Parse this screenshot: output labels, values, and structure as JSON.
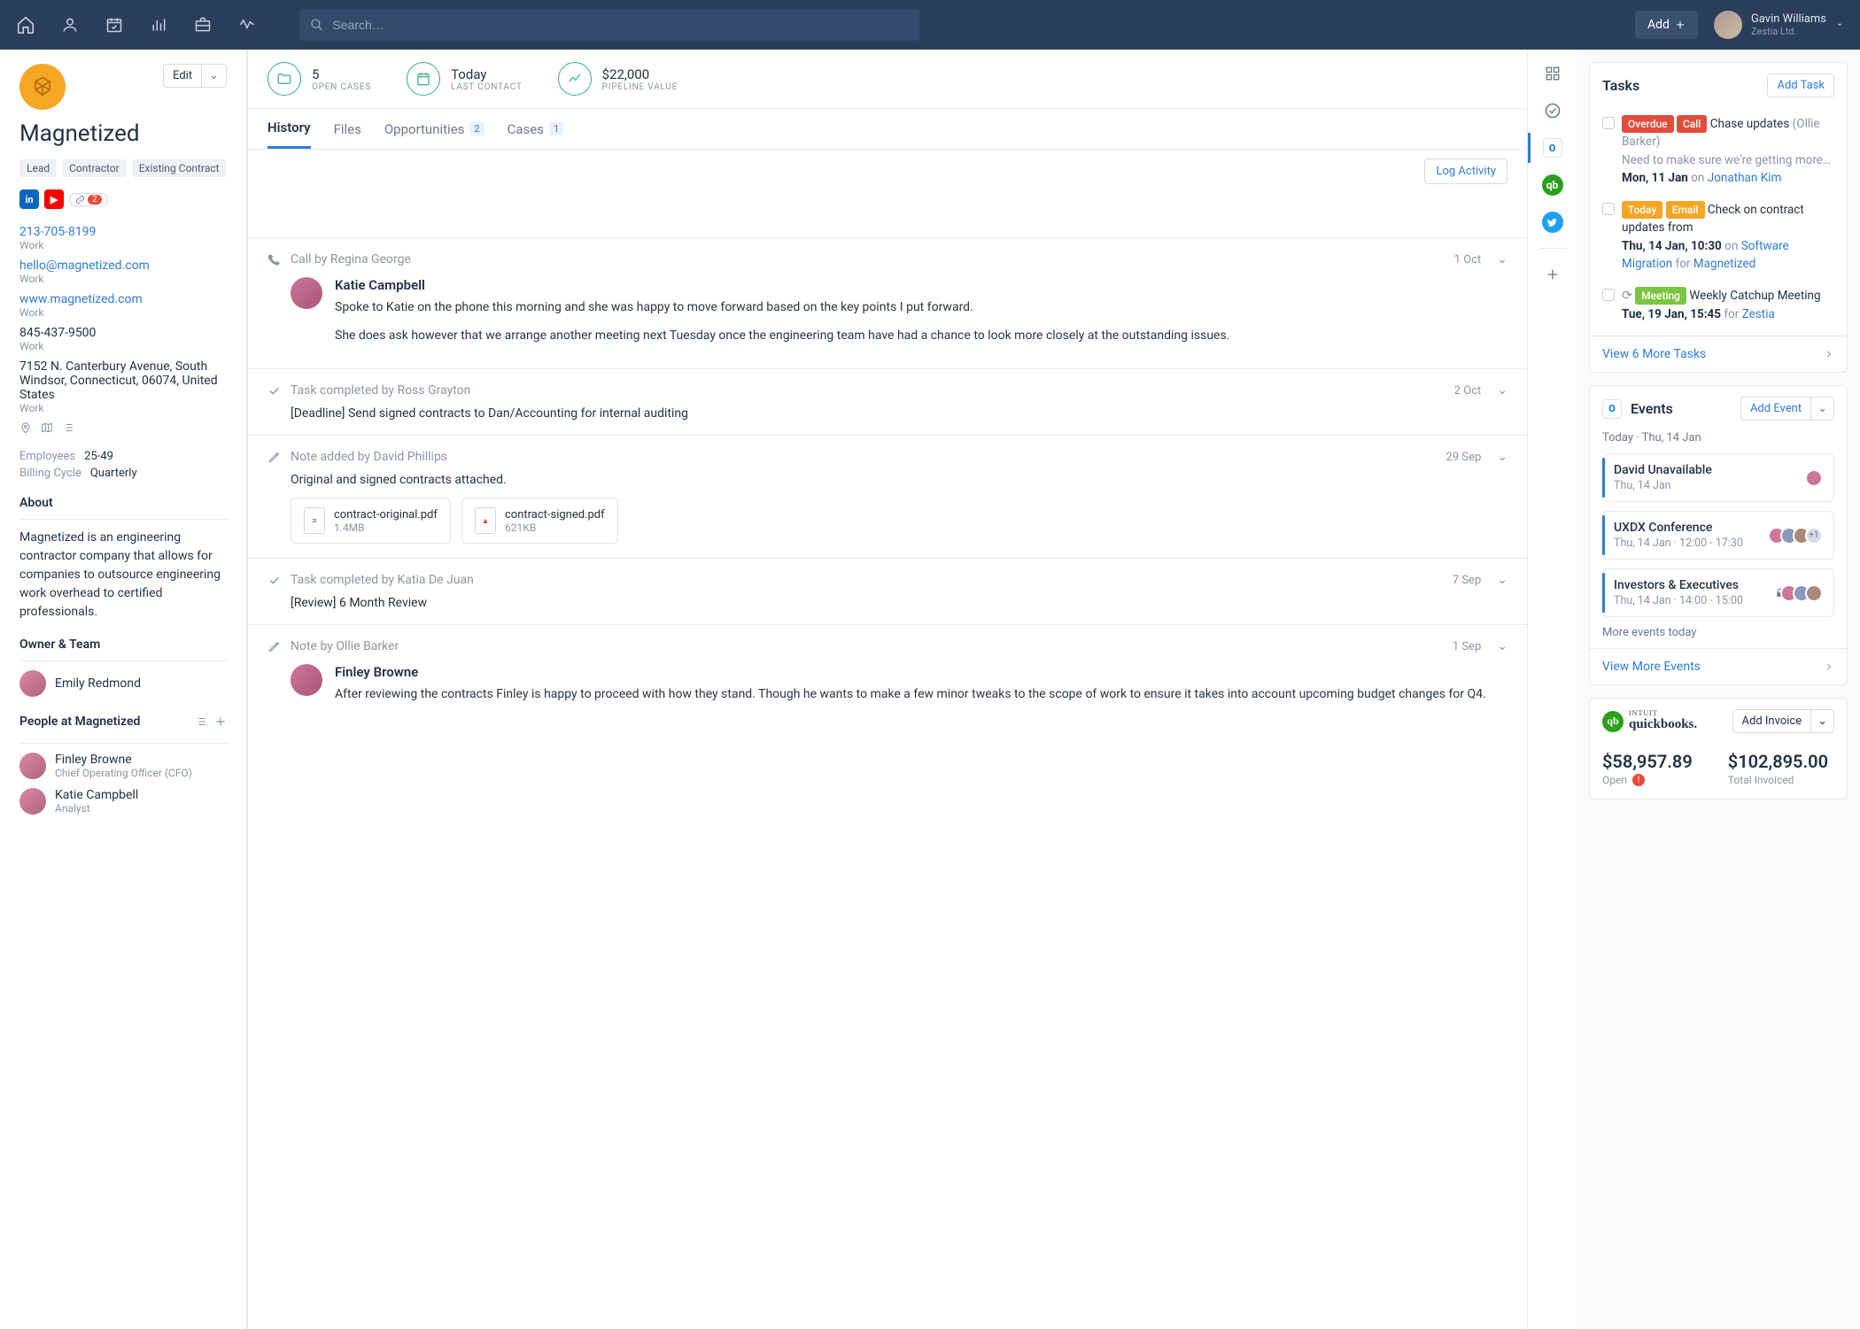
{
  "topnav": {
    "search_placeholder": "Search…",
    "add_label": "Add",
    "user": {
      "name": "Gavin Williams",
      "company": "Zestia Ltd."
    }
  },
  "org": {
    "name": "Magnetized",
    "edit_label": "Edit",
    "tags": [
      "Lead",
      "Contractor",
      "Existing Contract"
    ],
    "social_link_count": "2",
    "contacts": [
      {
        "value": "213-705-8199",
        "label": "Work",
        "link": true
      },
      {
        "value": "hello@magnetized.com",
        "label": "Work",
        "link": true
      },
      {
        "value": "www.magnetized.com",
        "label": "Work",
        "link": true
      },
      {
        "value": "845-437-9500",
        "label": "Work",
        "link": false
      },
      {
        "value": "7152 N. Canterbury Avenue, South Windsor, Connecticut, 06074, United States",
        "label": "Work",
        "link": false
      }
    ],
    "meta": [
      {
        "k": "Employees",
        "v": "25-49"
      },
      {
        "k": "Billing Cycle",
        "v": "Quarterly"
      }
    ],
    "about_title": "About",
    "about": "Magnetized is an engineering contractor company that allows for companies to outsource engineering work overhead to certified professionals.",
    "owner_title": "Owner & Team",
    "owner": {
      "name": "Emily Redmond"
    },
    "people_title": "People at Magnetized",
    "people": [
      {
        "name": "Finley Browne",
        "title": "Chief Operating Officer (CFO)"
      },
      {
        "name": "Katie Campbell",
        "title": "Analyst"
      }
    ]
  },
  "metrics": [
    {
      "value": "5",
      "label": "OPEN CASES",
      "icon": "folder"
    },
    {
      "value": "Today",
      "label": "LAST CONTACT",
      "icon": "calendar"
    },
    {
      "value": "$22,000",
      "label": "PIPELINE VALUE",
      "icon": "trend"
    }
  ],
  "tabs": {
    "history": "History",
    "files": "Files",
    "opportunities": "Opportunities",
    "opportunities_count": "2",
    "cases": "Cases",
    "cases_count": "1"
  },
  "log_activity_label": "Log Activity",
  "history": [
    {
      "type": "call",
      "title": "Call by Regina George",
      "date": "1 Oct",
      "entry": {
        "name": "Katie Campbell",
        "paras": [
          "Spoke to Katie on the phone this morning and she was happy to move forward based on the key points I put forward.",
          "She does ask however that we arrange another meeting next Tuesday once the engineering team have had a chance to look more closely at the outstanding issues."
        ]
      }
    },
    {
      "type": "task",
      "title": "Task completed by Ross Grayton",
      "date": "2 Oct",
      "simple": "[Deadline] Send signed contracts to Dan/Accounting for internal auditing"
    },
    {
      "type": "note",
      "title": "Note added by David Phillips",
      "date": "29 Sep",
      "simple": "Original and signed contracts attached.",
      "files": [
        {
          "name": "contract-original.pdf",
          "size": "1.4MB",
          "kind": "doc"
        },
        {
          "name": "contract-signed.pdf",
          "size": "621KB",
          "kind": "pdf"
        }
      ]
    },
    {
      "type": "task",
      "title": "Task completed by Katia De Juan",
      "date": "7 Sep",
      "simple": "[Review] 6 Month Review"
    },
    {
      "type": "note",
      "title": "Note by Ollie Barker",
      "date": "1 Sep",
      "entry": {
        "name": "Finley Browne",
        "paras": [
          "After reviewing the contracts Finley is happy to proceed with how they stand. Though he wants to make a few minor tweaks to the scope of work to ensure it takes into account upcoming budget changes for Q4."
        ]
      }
    }
  ],
  "tasks_panel": {
    "title": "Tasks",
    "add_label": "Add Task",
    "footer": "View 6 More Tasks",
    "items": [
      {
        "pills": [
          [
            "Overdue",
            "red"
          ],
          [
            "Call",
            "red"
          ]
        ],
        "text": "Chase updates",
        "paren": "(Ollie Barker)",
        "sub": "Need to make sure we're getting more…",
        "when": "Mon, 11 Jan",
        "on_prefix": "on",
        "on_link": "Jonathan Kim"
      },
      {
        "pills": [
          [
            "Today",
            "orange"
          ],
          [
            "Email",
            "orange"
          ]
        ],
        "text": "Check on contract updates from",
        "when": "Thu, 14 Jan, 10:30",
        "on_prefix": "on",
        "on_link": "Software Migration",
        "for_prefix": "for",
        "for_link": "Magnetized"
      },
      {
        "repeat": true,
        "pills": [
          [
            "Meeting",
            "green"
          ]
        ],
        "text": "Weekly Catchup Meeting",
        "when": "Tue, 19 Jan, 15:45",
        "for_prefix": "for",
        "for_link": "Zestia"
      }
    ]
  },
  "events_panel": {
    "title": "Events",
    "add_label": "Add Event",
    "subtitle": "Today · Thu, 14 Jan",
    "items": [
      {
        "title": "David Unavailable",
        "time": "Thu, 14 Jan",
        "avatars": 1
      },
      {
        "title": "UXDX Conference",
        "time": "Thu, 14 Jan · 12:00 - 17:30",
        "avatars": 3,
        "more": "+1"
      },
      {
        "title": "Investors & Executives",
        "time": "Thu, 14 Jan · 14:00 - 15:00",
        "avatars": 3,
        "lock": true
      }
    ],
    "more_note": "More events today",
    "footer": "View More Events"
  },
  "qb_panel": {
    "brand": "quickbooks.",
    "intuit": "INTUIT",
    "add_label": "Add Invoice",
    "open_amt": "$58,957.89",
    "open_label": "Open",
    "total_amt": "$102,895.00",
    "total_label": "Total Invoiced"
  }
}
